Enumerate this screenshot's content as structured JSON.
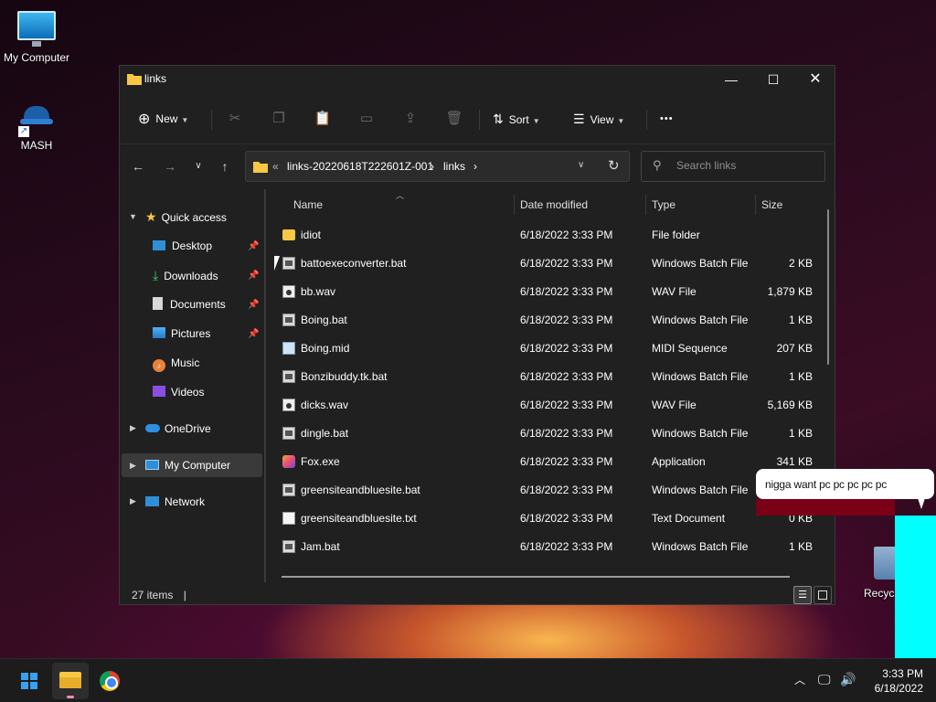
{
  "desktop": {
    "icons": [
      {
        "label": "My Computer",
        "icon": "computer-icon"
      },
      {
        "label": "MASH",
        "icon": "mash-icon"
      }
    ],
    "recycle_label": "Recycl",
    "bubble_text": "nigga want pc pc pc pc pc"
  },
  "window": {
    "title": "links",
    "controls": {
      "minimize": "—",
      "maximize": "☐",
      "close": "✕"
    },
    "toolbar": {
      "new_label": "New",
      "sort_label": "Sort",
      "view_label": "View",
      "more_label": "•••"
    },
    "address": {
      "overflow": "«",
      "segments": [
        "links-20220618T222601Z-001",
        "links"
      ],
      "separator": "›"
    },
    "search": {
      "placeholder": "Search links"
    },
    "sidebar": {
      "quick_access": "Quick access",
      "items": [
        {
          "label": "Desktop",
          "pinned": true
        },
        {
          "label": "Downloads",
          "pinned": true
        },
        {
          "label": "Documents",
          "pinned": true
        },
        {
          "label": "Pictures",
          "pinned": true
        },
        {
          "label": "Music",
          "pinned": false
        },
        {
          "label": "Videos",
          "pinned": false
        }
      ],
      "onedrive": "OneDrive",
      "my_computer": "My Computer",
      "network": "Network"
    },
    "columns": {
      "name": "Name",
      "date": "Date modified",
      "type": "Type",
      "size": "Size"
    },
    "files": [
      {
        "name": "idiot",
        "date": "6/18/2022 3:33 PM",
        "type": "File folder",
        "size": "",
        "icon": "folder"
      },
      {
        "name": "battoexeconverter.bat",
        "date": "6/18/2022 3:33 PM",
        "type": "Windows Batch File",
        "size": "2 KB",
        "icon": "bat"
      },
      {
        "name": "bb.wav",
        "date": "6/18/2022 3:33 PM",
        "type": "WAV File",
        "size": "1,879 KB",
        "icon": "wav"
      },
      {
        "name": "Boing.bat",
        "date": "6/18/2022 3:33 PM",
        "type": "Windows Batch File",
        "size": "1 KB",
        "icon": "bat"
      },
      {
        "name": "Boing.mid",
        "date": "6/18/2022 3:33 PM",
        "type": "MIDI Sequence",
        "size": "207 KB",
        "icon": "mid"
      },
      {
        "name": "Bonzibuddy.tk.bat",
        "date": "6/18/2022 3:33 PM",
        "type": "Windows Batch File",
        "size": "1 KB",
        "icon": "bat"
      },
      {
        "name": "dicks.wav",
        "date": "6/18/2022 3:33 PM",
        "type": "WAV File",
        "size": "5,169 KB",
        "icon": "wav"
      },
      {
        "name": "dingle.bat",
        "date": "6/18/2022 3:33 PM",
        "type": "Windows Batch File",
        "size": "1 KB",
        "icon": "bat"
      },
      {
        "name": "Fox.exe",
        "date": "6/18/2022 3:33 PM",
        "type": "Application",
        "size": "341 KB",
        "icon": "exe"
      },
      {
        "name": "greensiteandbluesite.bat",
        "date": "6/18/2022 3:33 PM",
        "type": "Windows Batch File",
        "size": "",
        "icon": "bat"
      },
      {
        "name": "greensiteandbluesite.txt",
        "date": "6/18/2022 3:33 PM",
        "type": "Text Document",
        "size": "0 KB",
        "icon": "txt"
      },
      {
        "name": "Jam.bat",
        "date": "6/18/2022 3:33 PM",
        "type": "Windows Batch File",
        "size": "1 KB",
        "icon": "bat"
      }
    ],
    "status": {
      "count": "27 items",
      "separator": "|"
    }
  },
  "taskbar": {
    "clock_time": "3:33 PM",
    "clock_date": "6/18/2022"
  },
  "colors": {
    "cyan_block": "#00ffff",
    "accent": "#3aa0f0"
  }
}
